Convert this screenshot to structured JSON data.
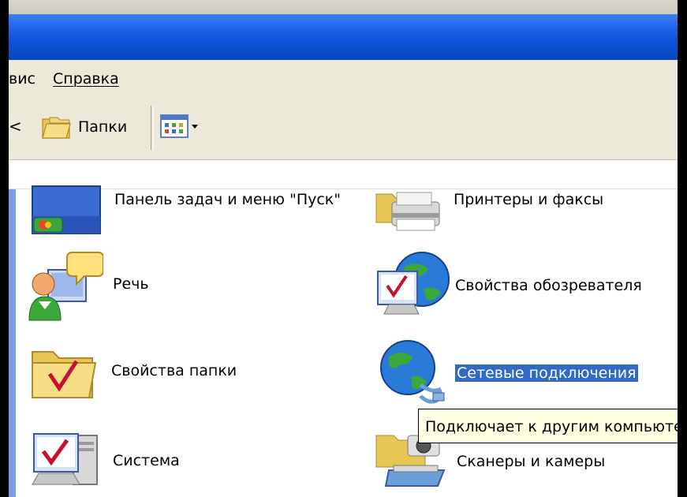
{
  "menu": {
    "service_label": "вис",
    "help_label": "Справка"
  },
  "toolbar": {
    "back_fragment": "<",
    "folders_label": "Папки"
  },
  "items": [
    {
      "label": "Панель задач и меню \"Пуск\"",
      "icon": "taskbar-icon"
    },
    {
      "label": "Принтеры и факсы",
      "icon": "printer-icon"
    },
    {
      "label": "Речь",
      "icon": "speech-icon"
    },
    {
      "label": "Свойства обозревателя",
      "icon": "internet-options-icon"
    },
    {
      "label": "Свойства папки",
      "icon": "folder-options-icon"
    },
    {
      "label": "Сетевые подключения",
      "icon": "network-connections-icon"
    },
    {
      "label": "Система",
      "icon": "system-icon"
    },
    {
      "label": "Сканеры и камеры",
      "icon": "scanners-cameras-icon"
    }
  ],
  "tooltip": {
    "text": "Подключает к другим компьютерам"
  },
  "colors": {
    "titlebar": "#0a53d8",
    "selection": "#316ac5",
    "tooltip_bg": "#ffffe1"
  }
}
